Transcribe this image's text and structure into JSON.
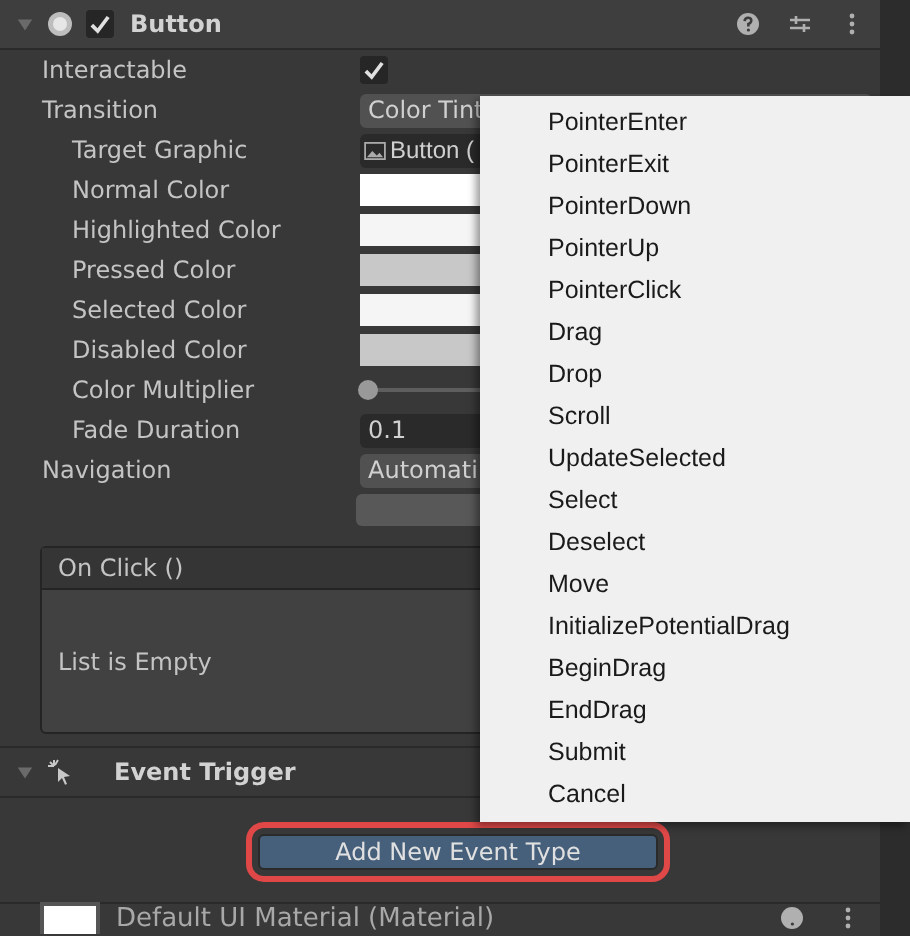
{
  "component": {
    "title": "Button",
    "enabled": true,
    "expanded": true
  },
  "properties": [
    {
      "kind": "checkbox",
      "label": "Interactable",
      "checked": true
    },
    {
      "kind": "dropdown",
      "label": "Transition",
      "value": "Color Tint",
      "children": [
        {
          "kind": "object",
          "label": "Target Graphic",
          "value": "Button ("
        },
        {
          "kind": "color",
          "label": "Normal Color",
          "color": "#ffffff"
        },
        {
          "kind": "color",
          "label": "Highlighted Color",
          "color": "#f5f5f5"
        },
        {
          "kind": "color",
          "label": "Pressed Color",
          "color": "#c8c8c8"
        },
        {
          "kind": "color",
          "label": "Selected Color",
          "color": "#f5f5f5"
        },
        {
          "kind": "color",
          "label": "Disabled Color",
          "color": "#c8c8c8"
        },
        {
          "kind": "slider",
          "label": "Color Multiplier",
          "level": 0
        },
        {
          "kind": "number",
          "label": "Fade Duration",
          "value": "0.1"
        }
      ]
    },
    {
      "kind": "dropdown",
      "label": "Navigation",
      "value": "Automati"
    },
    {
      "kind": "button"
    }
  ],
  "on_click": {
    "title": "On Click ()",
    "empty_text": "List is Empty"
  },
  "event_trigger": {
    "title": "Event Trigger",
    "expanded": true,
    "add_button": "Add New Event Type",
    "highlighted": true
  },
  "material": {
    "title": "Default UI Material (Material)"
  },
  "menu": {
    "items": [
      "PointerEnter",
      "PointerExit",
      "PointerDown",
      "PointerUp",
      "PointerClick",
      "Drag",
      "Drop",
      "Scroll",
      "UpdateSelected",
      "Select",
      "Deselect",
      "Move",
      "InitializePotentialDrag",
      "BeginDrag",
      "EndDrag",
      "Submit",
      "Cancel"
    ]
  }
}
